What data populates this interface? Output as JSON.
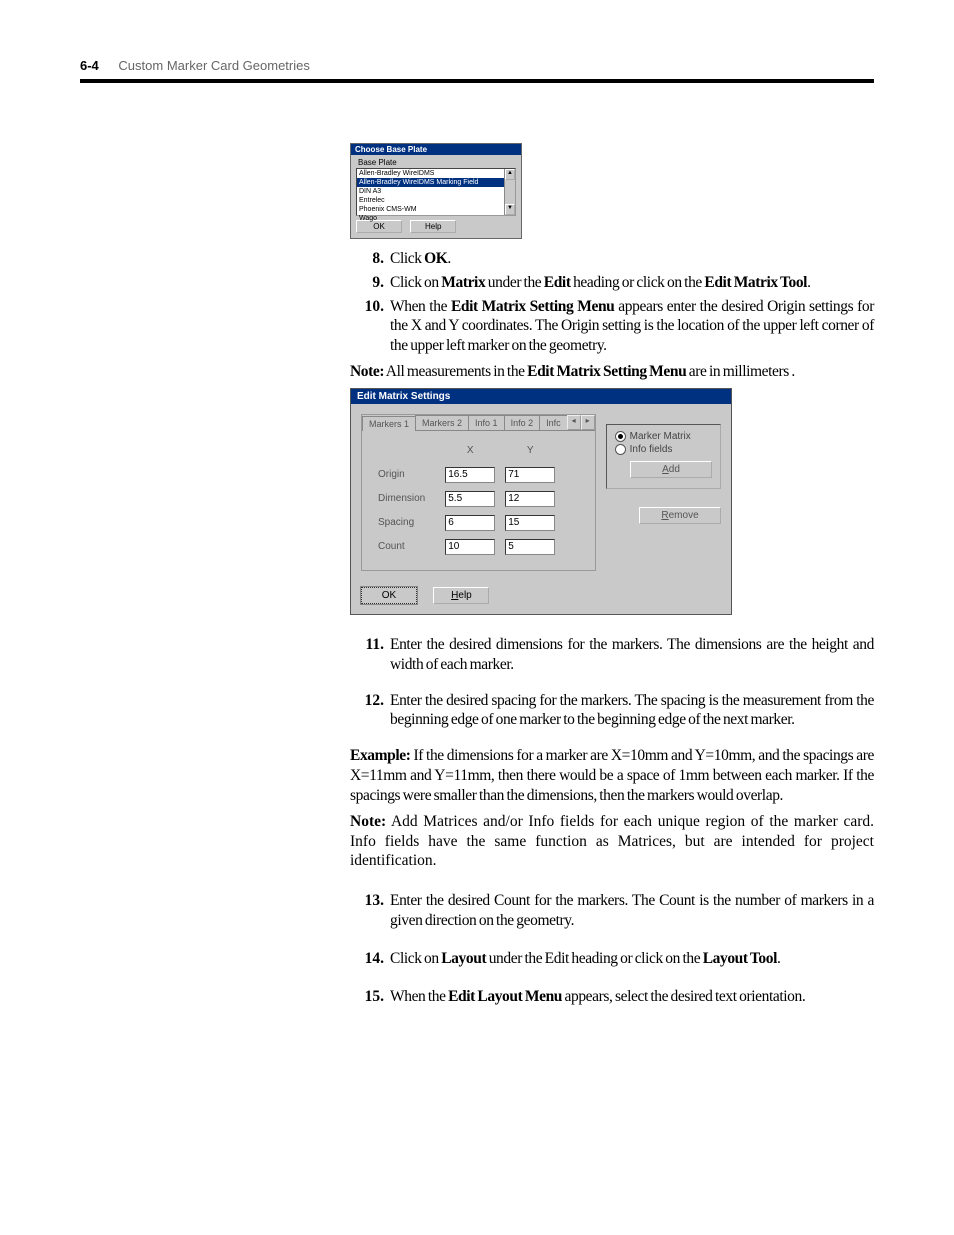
{
  "header": {
    "page_num": "6-4",
    "title": "Custom Marker Card Geometries"
  },
  "dlg1": {
    "title": "Choose Base Plate",
    "group_label": "Base Plate",
    "items": [
      "Allen-Bradley WireIDMS",
      "Allen-Bradley WireIDMS Marking Field",
      "DIN A3",
      "Entrelec",
      "Phoenix CMS-WM",
      "Wago"
    ],
    "selected_index": 1,
    "ok": "OK",
    "help": "Help"
  },
  "steps_a": [
    {
      "n": "8.",
      "html": "Click <b>OK</b>."
    },
    {
      "n": "9.",
      "html": "Click on <b>Matrix</b> under the <b>Edit</b> heading or click on the <b>Edit Matrix Tool</b>."
    },
    {
      "n": "10.",
      "html": "When the <b>Edit Matrix Setting Menu</b> appears enter the desired Origin settings for the X and Y coordinates. The Origin setting is the location of the upper left corner of the upper left marker on the geometry."
    }
  ],
  "note1": "<b>Note:</b> All measurements in the <b>Edit Matrix Setting Menu</b> are in millimeters .",
  "dlg2": {
    "title": "Edit Matrix Settings",
    "tabs": [
      "Markers 1",
      "Markers 2",
      "Info 1",
      "Info 2",
      "Infc"
    ],
    "col_x": "X",
    "col_y": "Y",
    "rows": [
      {
        "label": "Origin",
        "x": "16.5",
        "y": "71"
      },
      {
        "label": "Dimension",
        "x": "5.5",
        "y": "12"
      },
      {
        "label": "Spacing",
        "x": "6",
        "y": "15"
      },
      {
        "label": "Count",
        "x": "10",
        "y": "5"
      }
    ],
    "radio1": "Marker Matrix",
    "radio2": "Info fields",
    "add": "Add",
    "remove": "Remove",
    "ok": "OK",
    "help": "Help"
  },
  "steps_b": [
    {
      "n": "11.",
      "html": "Enter the desired dimensions for the markers. The dimensions are the height and width of each marker."
    },
    {
      "n": "12.",
      "html": "Enter the desired spacing for the markers. The spacing is the measurement from the beginning edge of one marker to the beginning edge of the next marker."
    }
  ],
  "example": "<b>Example:</b> If the dimensions for a marker are X=10mm and Y=10mm, and the spacings are X=11mm and Y=11mm, then there would be a space of 1mm between each marker. If the spacings were smaller than the dimensions, then the markers would overlap.",
  "note2": "<b>Note:</b> Add Matrices and/or Info fields for each unique region of the marker card. Info fields have the same function as Matrices, but are intended for project identification.",
  "steps_c": [
    {
      "n": "13.",
      "html": "Enter the desired Count for the markers. The Count is the number of markers in a given direction on the geometry."
    },
    {
      "n": "14.",
      "html": "Click on <b>Layout</b> under the Edit heading or click on the <b>Layout Tool</b>."
    },
    {
      "n": "15.",
      "html": "When the <b>Edit Layout Menu</b> appears, select the desired text orientation."
    }
  ]
}
